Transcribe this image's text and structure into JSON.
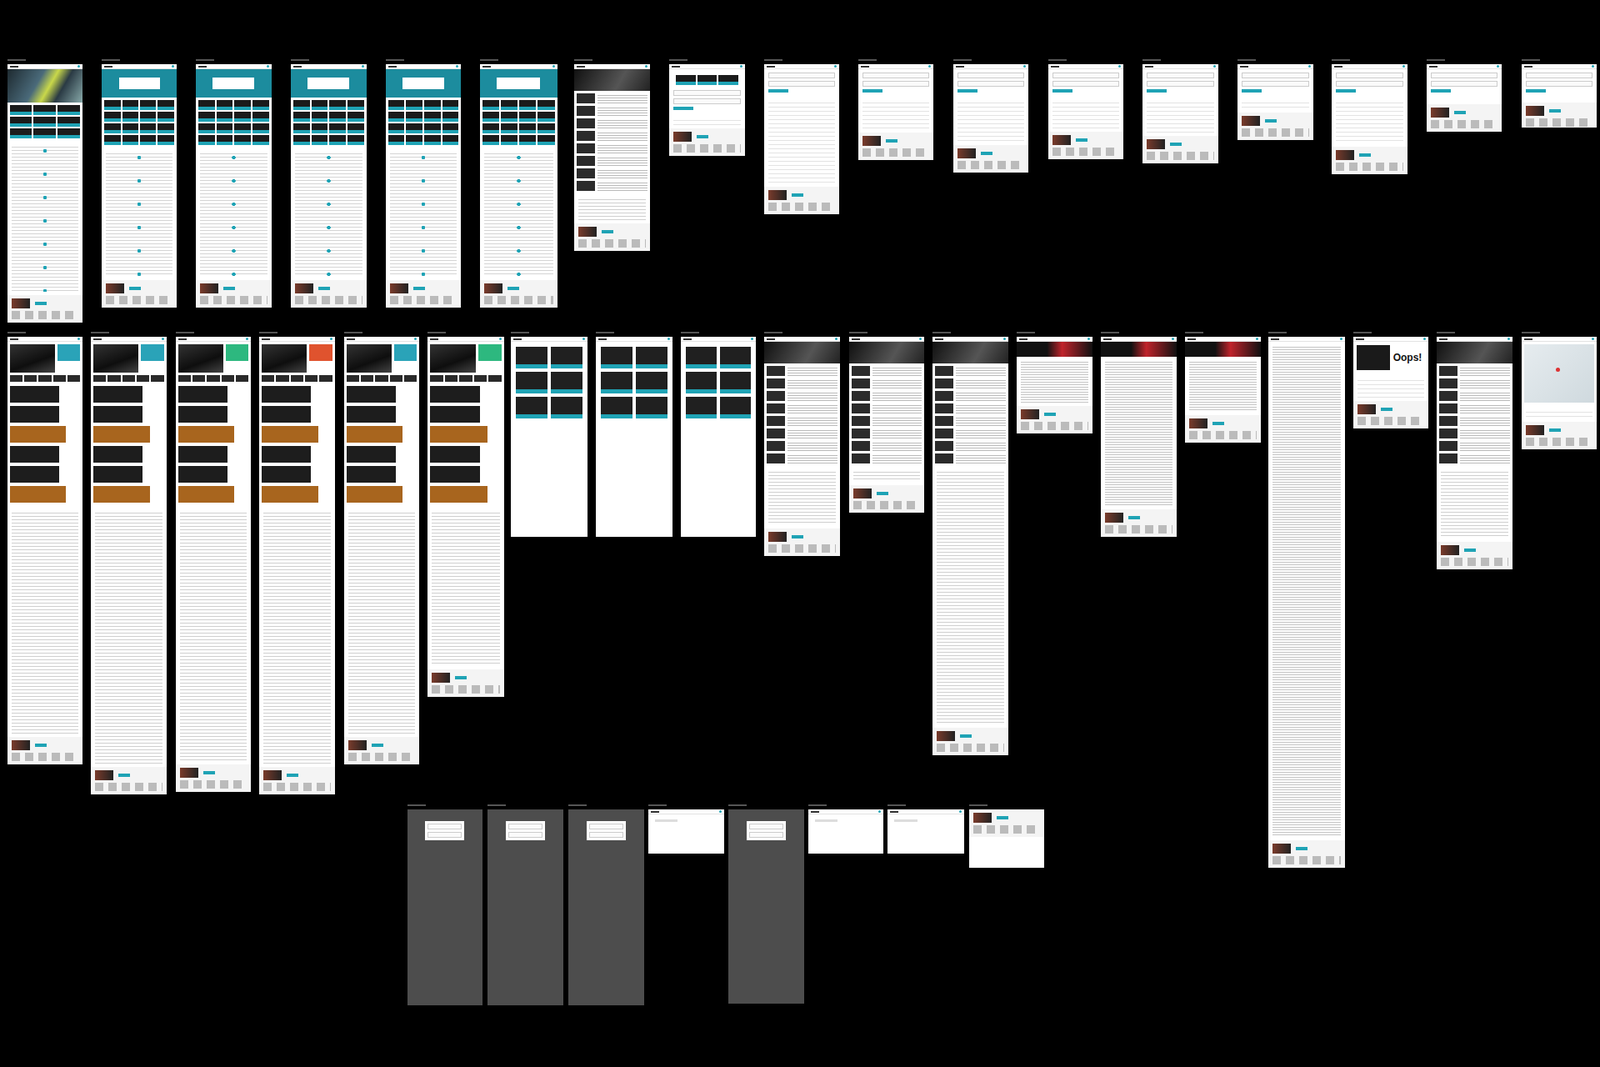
{
  "frames": [
    {
      "kind": "home"
    },
    {
      "kind": "category"
    },
    {
      "kind": "category"
    },
    {
      "kind": "category"
    },
    {
      "kind": "category"
    },
    {
      "kind": "category"
    },
    {
      "kind": "article"
    },
    {
      "kind": "cart"
    },
    {
      "kind": "checkout"
    },
    {
      "kind": "form"
    },
    {
      "kind": "form"
    },
    {
      "kind": "form"
    },
    {
      "kind": "form"
    },
    {
      "kind": "form"
    },
    {
      "kind": "form"
    },
    {
      "kind": "form"
    },
    {
      "kind": "form"
    },
    {
      "kind": "product",
      "color": "#2aa3b8"
    },
    {
      "kind": "product",
      "color": "#2aa3b8"
    },
    {
      "kind": "product",
      "color": "#2db87f"
    },
    {
      "kind": "product",
      "color": "#e0532e"
    },
    {
      "kind": "product",
      "color": "#2aa3b8"
    },
    {
      "kind": "product",
      "color": "#2db87f"
    },
    {
      "kind": "grid"
    },
    {
      "kind": "grid"
    },
    {
      "kind": "grid"
    },
    {
      "kind": "article"
    },
    {
      "kind": "article"
    },
    {
      "kind": "post"
    },
    {
      "kind": "legal"
    },
    {
      "kind": "legal"
    },
    {
      "kind": "legal"
    },
    {
      "kind": "policy"
    },
    {
      "kind": "error",
      "heading": "Oops!"
    },
    {
      "kind": "article"
    },
    {
      "kind": "map"
    },
    {
      "kind": "dark"
    },
    {
      "kind": "dark"
    },
    {
      "kind": "dark"
    },
    {
      "kind": "blank"
    },
    {
      "kind": "dark"
    },
    {
      "kind": "blank"
    },
    {
      "kind": "blank"
    },
    {
      "kind": "footer"
    }
  ]
}
